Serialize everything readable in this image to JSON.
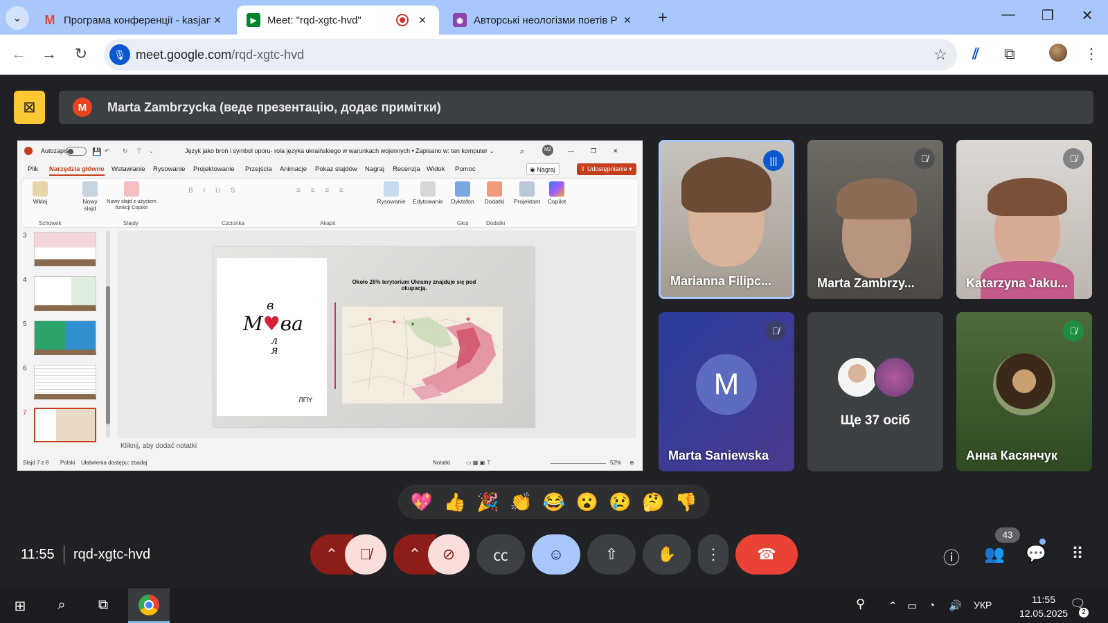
{
  "browser": {
    "tabs": [
      {
        "title": "Програма конференції - kasjan",
        "icon": "gmail-icon",
        "active": false
      },
      {
        "title": "Meet: \"rqd-xgtc-hvd\"",
        "icon": "google-meet-icon",
        "active": true,
        "recording": true
      },
      {
        "title": "Авторські неологізми поетів Р",
        "icon": "lens-icon",
        "active": false
      }
    ],
    "url_host": "meet.google.com",
    "url_path": "/rqd-xgtc-hvd"
  },
  "meet": {
    "presenter_initial": "M",
    "presenter_text": "Marta Zambrzycka (веде презентацію, додає примітки)",
    "time": "11:55",
    "meeting_code": "rqd-xgtc-hvd",
    "participants_count": "43",
    "reactions": [
      "💖",
      "👍",
      "🎉",
      "👏",
      "😂",
      "😮",
      "😢",
      "🤔",
      "👎"
    ],
    "tiles": [
      {
        "name": "Marianna Filipc...",
        "status": "speaking"
      },
      {
        "name": "Marta Zambrzy...",
        "status": "muted"
      },
      {
        "name": "Katarzyna Jaku...",
        "status": "muted"
      },
      {
        "name": "Marta Saniewska",
        "status": "muted",
        "initial": "M"
      },
      {
        "name": "Ще 37 осіб",
        "status": "none"
      },
      {
        "name": "Анна Касянчук",
        "status": "muted"
      }
    ]
  },
  "powerpoint": {
    "autosave": "Autozapis",
    "doc_title": "Język jako broń i symbol oporu- rola języka ukraińskiego w warunkach wojennych • Zapisano w: ten komputer ⌄",
    "user_initials": "MZ",
    "menu": [
      "Plik",
      "Narzędzia główne",
      "Wstawianie",
      "Rysowanie",
      "Projektowanie",
      "Przejścia",
      "Animacje",
      "Pokaz slajdów",
      "Nagraj",
      "Recenzja",
      "Widok",
      "Pomoc"
    ],
    "record_label": "Nagraj",
    "share_label": "Udostępnianie ▾",
    "ribbon": {
      "paste": "Wklej",
      "new_slide": "Nowy slajd",
      "copilot_slide": "Nowy slajd z użyciem funkcji Copilot",
      "drawing": "Rysowanie",
      "editing": "Edytowanie",
      "dictate": "Dyktafon",
      "addins": "Dodatki",
      "designer": "Projektant",
      "copilot": "Copilot",
      "groups": [
        "Schowek",
        "Slajdy",
        "Czcionka",
        "Akapit",
        "Głos",
        "Dodatki"
      ]
    },
    "thumb_numbers": [
      "3",
      "4",
      "5",
      "6",
      "7"
    ],
    "slide_caption": "Około 26% terytorium Ukrainy znajduje się pod okupacją.",
    "notes_placeholder": "Kliknij, aby dodać notatki",
    "status_slide": "Slajd 7 z 8",
    "status_lang": "Polski",
    "status_access": "Ułatwienia dostępu: zbadaj",
    "status_notes": "Notatki",
    "zoom": "52%",
    "art": {
      "top": "в",
      "main_left": "М",
      "main_right": "ва",
      "bottom": "л\nя",
      "signature": "ЛПY"
    }
  },
  "taskbar": {
    "lang": "УКР",
    "time": "11:55",
    "date": "12.05.2025",
    "notifications": "2"
  }
}
